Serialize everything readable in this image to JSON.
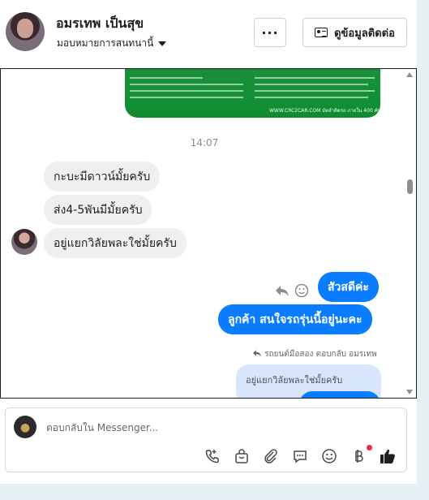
{
  "header": {
    "contact_name": "อมรเทพ เป็นสุข",
    "assign_label": "มอบหมายการสนทนานี้",
    "more_label": "···",
    "info_button_label": "ดูข้อมูลติดต่อ"
  },
  "chat": {
    "image_caption": "WWW.CRC2CAR.COM มัดจำติดรถ ภายใน 400 คัน",
    "timestamp": "14:07",
    "incoming": [
      {
        "text": "กะบะมีดาวน์มั้ยครับ"
      },
      {
        "text": "ส่ง4-5พันมีมั้ยครับ"
      },
      {
        "text": "อยู่แยกวิลัยพละใช่มั้ยครับ"
      }
    ],
    "outgoing": [
      {
        "text": "สัวสดีค่ะ"
      },
      {
        "text": "ลูกค้า  สนใจรถรุ่นนี้อยู่นะคะ"
      }
    ],
    "reply_meta": "รถยนต์มือสอง ตอบกลับ อมรเทพ",
    "quoted_text": "อยู่แยกวิลัยพละใช่มั้ยครับ"
  },
  "composer": {
    "placeholder": "ตอบกลับใน Messenger..."
  },
  "icons": [
    "search-icon",
    "reply-icon",
    "smile-icon",
    "call-icon",
    "bag-icon",
    "paperclip-icon",
    "chat-icon",
    "emoji-icon",
    "baht-icon",
    "thumbs-up-icon"
  ],
  "colors": {
    "outgoing_bubble": "#0a7cff",
    "incoming_bubble": "#efeff1",
    "like": "#0a7cff"
  }
}
